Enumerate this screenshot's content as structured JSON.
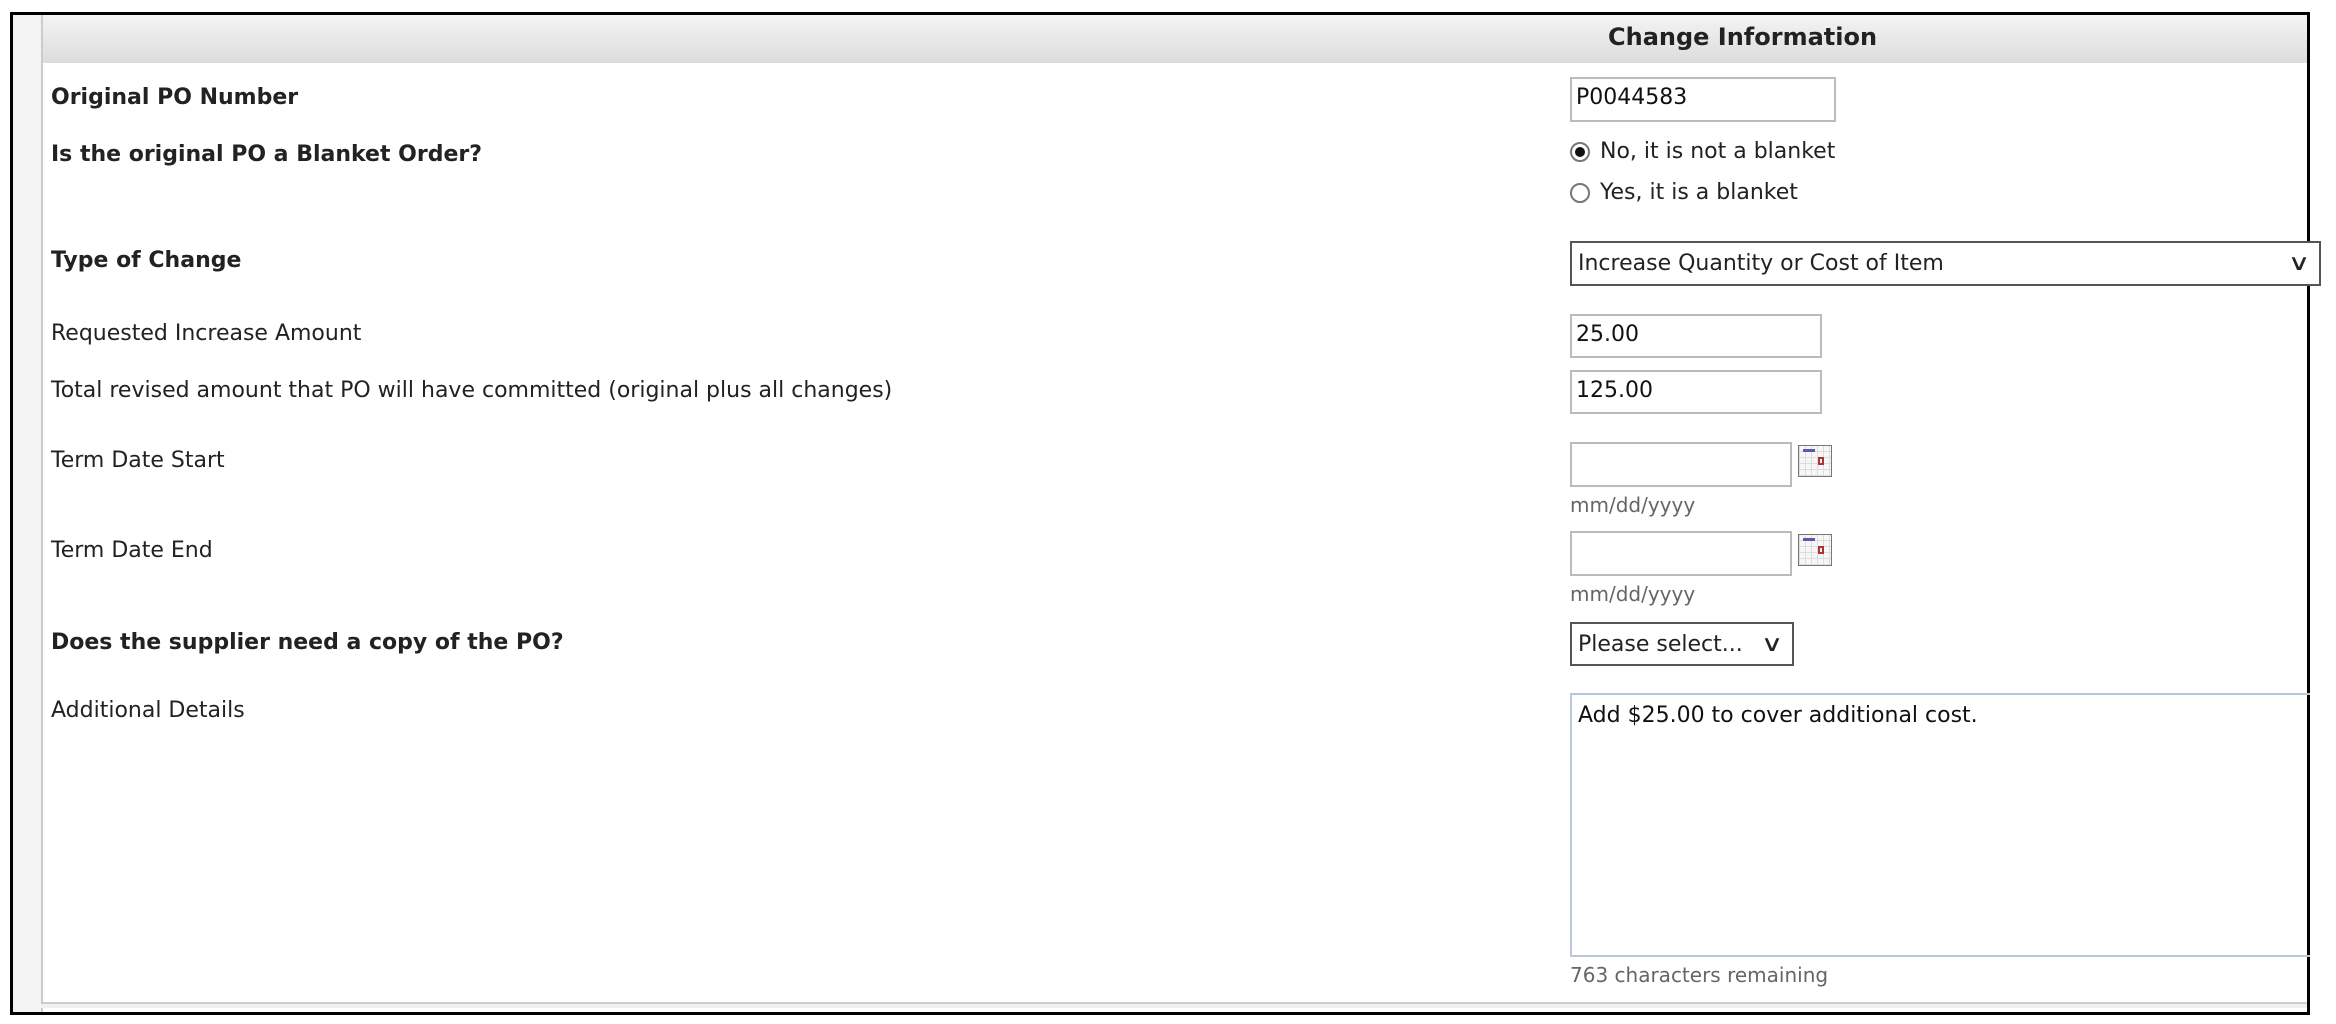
{
  "header": {
    "title": "Change Information"
  },
  "fields": {
    "po_number": {
      "label": "Original PO Number",
      "value": "P0044583"
    },
    "blanket": {
      "label": "Is the original PO a Blanket Order?",
      "options": [
        {
          "label": "No, it is not a blanket",
          "selected": true
        },
        {
          "label": "Yes, it is a blanket",
          "selected": false
        }
      ]
    },
    "type_of_change": {
      "label": "Type of Change",
      "value": "Increase Quantity or Cost of Item"
    },
    "increase_amount": {
      "label": "Requested Increase Amount",
      "value": "25.00"
    },
    "total_revised": {
      "label": "Total revised amount that PO will have committed (original plus all changes)",
      "value": "125.00"
    },
    "term_start": {
      "label": "Term Date Start",
      "value": "",
      "hint": "mm/dd/yyyy"
    },
    "term_end": {
      "label": "Term Date End",
      "value": "",
      "hint": "mm/dd/yyyy"
    },
    "supplier_copy": {
      "label": "Does the supplier need a copy of the PO?",
      "value": "Please select..."
    },
    "additional_details": {
      "label": "Additional Details",
      "value": "Add  $25.00 to cover additional cost.",
      "remaining": "763 characters remaining"
    }
  }
}
